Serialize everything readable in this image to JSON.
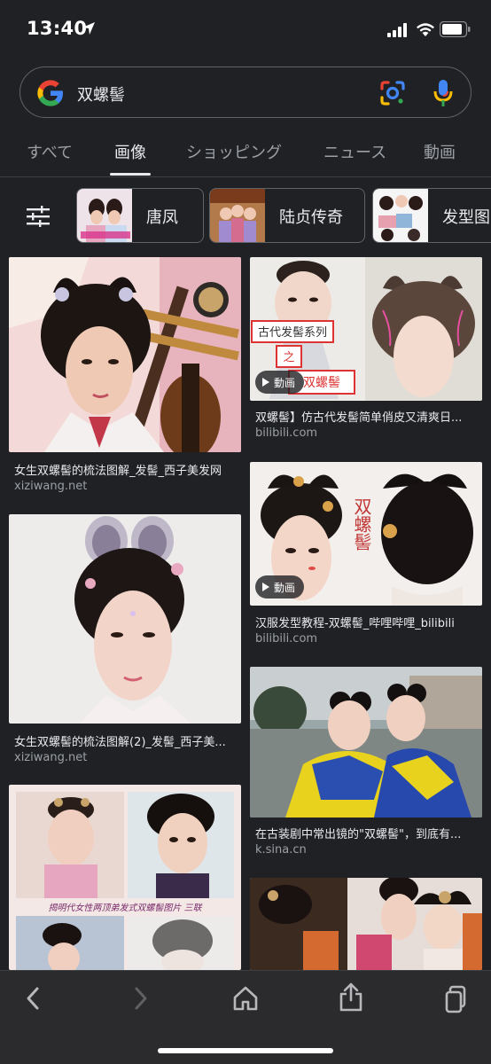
{
  "status": {
    "time": "13:40"
  },
  "search": {
    "query": "双螺髻"
  },
  "tabs": [
    {
      "label": "すべて",
      "active": false
    },
    {
      "label": "画像",
      "active": true
    },
    {
      "label": "ショッピング",
      "active": false
    },
    {
      "label": "ニュース",
      "active": false
    },
    {
      "label": "動画",
      "active": false
    }
  ],
  "chips": [
    {
      "label": "唐凤"
    },
    {
      "label": "陆贞传奇"
    },
    {
      "label": "发型图"
    }
  ],
  "results": {
    "left": [
      {
        "caption": "女生双螺髻的梳法图解_发髻_西子美发网",
        "domain": "xiziwang.net"
      },
      {
        "caption": "女生双螺髻的梳法图解(2)_发髻_西子美...",
        "domain": "xiziwang.net"
      },
      {
        "caption": "",
        "domain": ""
      }
    ],
    "right": [
      {
        "caption": "双螺髻】仿古代发髻简单俏皮又清爽日...",
        "domain": "bilibili.com",
        "badge": "動画",
        "overlay_tag1": "古代发髻系列",
        "overlay_tag2": "之",
        "overlay_tag3": "双螺髻"
      },
      {
        "caption": "汉服发型教程-双螺髻_哔哩哔哩_bilibili",
        "domain": "bilibili.com",
        "badge": "動画",
        "overlay_text": "双螺髻"
      },
      {
        "caption": "在古装剧中常出镜的\"双螺髻\"，到底有...",
        "domain": "k.sina.cn"
      },
      {
        "caption": "",
        "domain": ""
      }
    ],
    "overlay_banner": "揭明代女性两顶弟发式双螺髻图片 三联"
  },
  "colors": {
    "bg": "#202124",
    "text": "#e8eaed",
    "muted": "#9aa0a6",
    "border": "#5f6368"
  }
}
